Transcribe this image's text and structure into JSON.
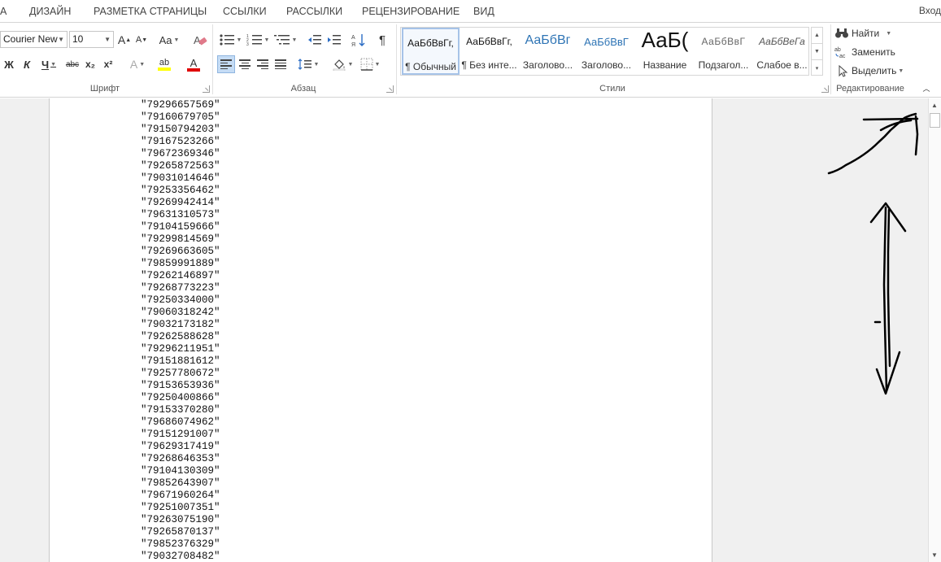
{
  "tabs": [
    "А",
    "ДИЗАЙН",
    "РАЗМЕТКА СТРАНИЦЫ",
    "ССЫЛКИ",
    "РАССЫЛКИ",
    "РЕЦЕНЗИРОВАНИЕ",
    "ВИД"
  ],
  "login": "Вход",
  "font": {
    "group_label": "Шрифт",
    "name": "Courier New",
    "size": "10",
    "grow": "A",
    "shrink": "A",
    "case": "Aa",
    "bold": "Ж",
    "italic": "К",
    "underline": "Ч",
    "strike": "abc",
    "sub": "x₂",
    "sup": "x²",
    "effects": "A",
    "highlight": "ab",
    "font_color": "A"
  },
  "paragraph": {
    "group_label": "Абзац",
    "pilcrow": "¶"
  },
  "styles": {
    "group_label": "Стили",
    "items": [
      {
        "sample": "АаБбВвГг,",
        "name": "¶ Обычный"
      },
      {
        "sample": "АаБбВвГг,",
        "name": "¶ Без инте..."
      },
      {
        "sample": "АаБбВг",
        "name": "Заголово..."
      },
      {
        "sample": "АаБбВвГ",
        "name": "Заголово..."
      },
      {
        "sample": "АаБ(",
        "name": "Название"
      },
      {
        "sample": "АаБбВвГ",
        "name": "Подзагол..."
      },
      {
        "sample": "АаБбВеГа",
        "name": "Слабое в..."
      }
    ]
  },
  "editing": {
    "group_label": "Редактирование",
    "find": "Найти",
    "replace": "Заменить",
    "select": "Выделить"
  },
  "document": {
    "lines": [
      "\"79296657569\"",
      "\"79160679705\"",
      "\"79150794203\"",
      "\"79167523266\"",
      "\"79672369346\"",
      "\"79265872563\"",
      "\"79031014646\"",
      "\"79253356462\"",
      "\"79269942414\"",
      "\"79631310573\"",
      "\"79104159666\"",
      "\"79299814569\"",
      "\"79269663605\"",
      "\"79859991889\"",
      "\"79262146897\"",
      "\"79268773223\"",
      "\"79250334000\"",
      "\"79060318242\"",
      "\"79032173182\"",
      "\"79262588628\"",
      "\"79296211951\"",
      "\"79151881612\"",
      "\"79257780672\"",
      "\"79153653936\"",
      "\"79250400866\"",
      "\"79153370280\"",
      "\"79686074962\"",
      "\"79151291007\"",
      "\"79629317419\"",
      "\"79268646353\"",
      "\"79104130309\"",
      "\"79852643907\"",
      "\"79671960264\"",
      "\"79251007351\"",
      "\"79263075190\"",
      "\"79265870137\"",
      "\"79852376329\"",
      "\"79032708482\""
    ]
  },
  "colors": {
    "selected_bg": "#c5dcf5",
    "highlight_yellow": "#ffff00",
    "font_red": "#e00000",
    "heading_blue": "#2e74b5"
  }
}
